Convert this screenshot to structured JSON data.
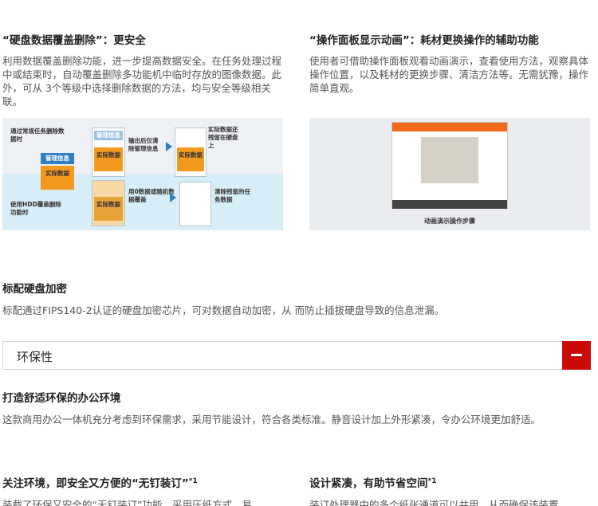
{
  "security": {
    "left": {
      "title": "“硬盘数据覆盖删除”：更安全",
      "body": "利用数据覆盖删除功能，进一步提高数据安全。在任务处理过程中或结束时，自动覆盖删除多功能机中临时存放的图像数据。此外，可从 3个等级中选择删除数据的方法，均与安全等级相关联。"
    },
    "right": {
      "title": "“操作面板显示动画”：耗材更换操作的辅助功能",
      "body": "使用者可借助操作面板观看动画演示，查看使用方法，观察具体操作位置，以及耗材的更换步骤、清洁方法等。无需犹豫，操作简单直观。"
    },
    "diagram": {
      "label_normal": "通过常规任务删除数据时",
      "label_hdd": "使用HDD覆盖删除功能时",
      "mgmt_info": "管理信息",
      "actual_data": "实际数据",
      "output_note": "输出后仅清除管理信息",
      "remain_note": "实际数据还残留在硬盘上",
      "random_note": "用0数据或随机数据覆盖",
      "clear_note": "清除残留的任务数据"
    },
    "anim_caption": "动画演示操作步骤",
    "hdd_encrypt": {
      "title": "标配硬盘加密",
      "body": "标配通过FIPS140-2认证的硬盘加密芯片，可对数据自动加密，从 而防止插拔硬盘导致的信息泄漏。"
    }
  },
  "eco_section": {
    "title": "环保性",
    "toggle_icon": "minus-icon"
  },
  "eco": {
    "office": {
      "title": "打造舒适环保的办公环境",
      "body": "这款商用办公一体机充分考虑到环保需求，采用节能设计，符合各类标准。静音设计加上外形紧凑，令办公环境更加舒适。"
    },
    "staple": {
      "title": "关注环境，即安全又方便的“无钉装订”",
      "sup": "*1",
      "body": "装载了环保又安全的“无钉装订”功能，采用压纸方式，易"
    },
    "compact": {
      "title": "设计紧凑，有助节省空间",
      "sup": "*1",
      "body": "装订处理器中的多个纸张通道可以共用，从而确保该装置"
    }
  }
}
